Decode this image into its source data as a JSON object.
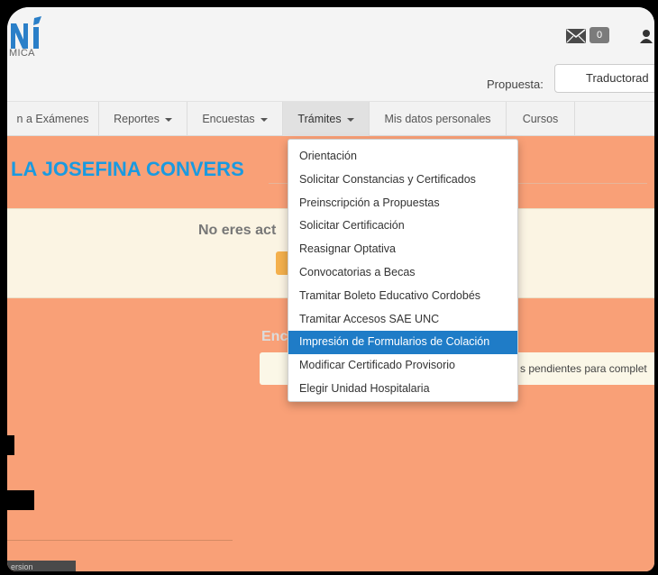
{
  "header": {
    "logo_text": "MICA",
    "mail_count": "0",
    "propuesta_label": "Propuesta:",
    "propuesta_value": "Traductorad"
  },
  "nav": {
    "items": [
      {
        "label": "n a Exámenes"
      },
      {
        "label": "Reportes"
      },
      {
        "label": "Encuestas"
      },
      {
        "label": "Trámites"
      },
      {
        "label": "Mis datos personales"
      },
      {
        "label": "Cursos"
      }
    ]
  },
  "main": {
    "student_name": "LA JOSEFINA CONVERS",
    "alert_text": "No eres act",
    "encuestas_title": "Enc",
    "info_text": "s pendientes para complet",
    "footer_tag": "ersion"
  },
  "dropdown": {
    "items": [
      {
        "label": "Orientación"
      },
      {
        "label": "Solicitar Constancias y Certificados"
      },
      {
        "label": "Preinscripción a Propuestas"
      },
      {
        "label": "Solicitar Certificación"
      },
      {
        "label": "Reasignar Optativa"
      },
      {
        "label": "Convocatorias a Becas"
      },
      {
        "label": "Tramitar Boleto Educativo Cordobés"
      },
      {
        "label": "Tramitar Accesos SAE UNC"
      },
      {
        "label": "Impresión de Formularios de Colación"
      },
      {
        "label": "Modificar Certificado Provisorio"
      },
      {
        "label": "Elegir Unidad Hospitalaria"
      }
    ],
    "highlighted_index": 8
  },
  "colors": {
    "accent": "#1f7cc7",
    "background_main": "#f9a077",
    "student_name": "#1a9ae0"
  }
}
